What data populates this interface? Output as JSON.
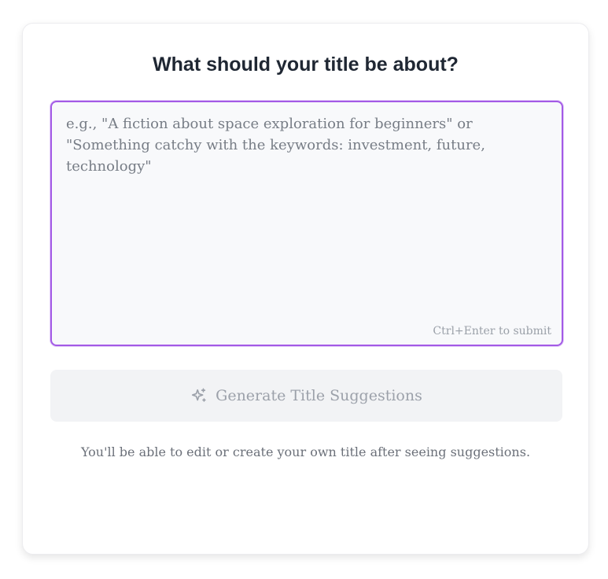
{
  "form": {
    "heading": "What should your title be about?",
    "prompt_value": "",
    "prompt_placeholder": "e.g., \"A fiction about space exploration for beginners\" or \"Something catchy with the keywords: investment, future, technology\"",
    "submit_hint": "Ctrl+Enter to submit",
    "generate_button": {
      "label": "Generate Title Suggestions",
      "icon": "sparkle-icon",
      "disabled": true
    },
    "footnote": "You'll be able to edit or create your own title after seeing suggestions."
  },
  "colors": {
    "accent_border": "#a35ae6",
    "heading_text": "#1f2733",
    "button_disabled_bg": "#f2f3f5",
    "button_disabled_text": "#9ca1aa"
  }
}
